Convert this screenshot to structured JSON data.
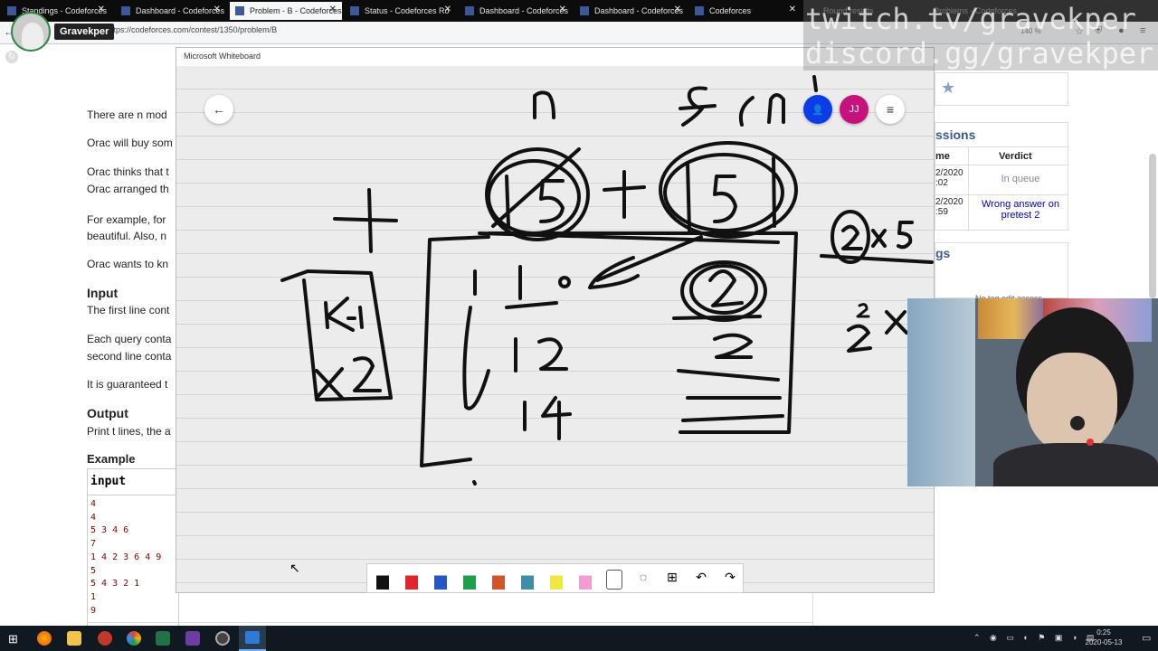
{
  "browser": {
    "tabs": [
      {
        "label": "Standings - Codeforces",
        "active": false
      },
      {
        "label": "Dashboard - Codeforces",
        "active": false
      },
      {
        "label": "Problem - B - Codeforces",
        "active": true
      },
      {
        "label": "Status - Codeforces Ro",
        "active": false
      },
      {
        "label": "Dashboard - Codeforces",
        "active": false
      },
      {
        "label": "Dashboard - Codeforces",
        "active": false
      },
      {
        "label": "Codeforces",
        "active": false
      },
      {
        "label": "Round results",
        "active": false
      },
      {
        "label": "Problems - Codeforces",
        "active": false
      }
    ],
    "url": "https://codeforces.com/contest/1350/problem/B",
    "zoom": "140 %"
  },
  "stream": {
    "name": "Gravekper",
    "watermark_line1": "twitch.tv/gravekper",
    "watermark_line2": "discord.gg/gravekper"
  },
  "problem": {
    "p1": "There are n mod",
    "p2": "Orac will buy som",
    "p3a": "Orac thinks that t",
    "p3b": "Orac arranged th",
    "p4a": "For example, for",
    "p4b": "beautiful. Also, n",
    "p5": "Orac wants to kn",
    "input_head": "Input",
    "input1": "The first line cont",
    "input2a": "Each query conta",
    "input2b": "second line conta",
    "input3": "It is guaranteed t",
    "output_head": "Output",
    "output1": "Print t lines, the a",
    "example_head": "Example",
    "example_label": "input",
    "example_lines": [
      "4",
      "4",
      "5 3 4 6",
      "7",
      "1 4 2 3 6 4 9",
      "5",
      "5 4 3 2 1",
      "1",
      "9"
    ]
  },
  "sidebar": {
    "submissions_title": "ssions",
    "col_time": "me",
    "col_verdict": "Verdict",
    "rows": [
      {
        "time": "2/2020\n:02",
        "verdict": "In queue"
      },
      {
        "time": "2/2020\n:59",
        "verdict": "Wrong answer on pretest 2"
      }
    ],
    "tags_title": "gs",
    "tags_note": "No tag edit access"
  },
  "whiteboard": {
    "title": "Microsoft Whiteboard",
    "user_initials": "JJ"
  },
  "taskbar": {
    "time": "0:25",
    "date": "2020-05-13"
  }
}
